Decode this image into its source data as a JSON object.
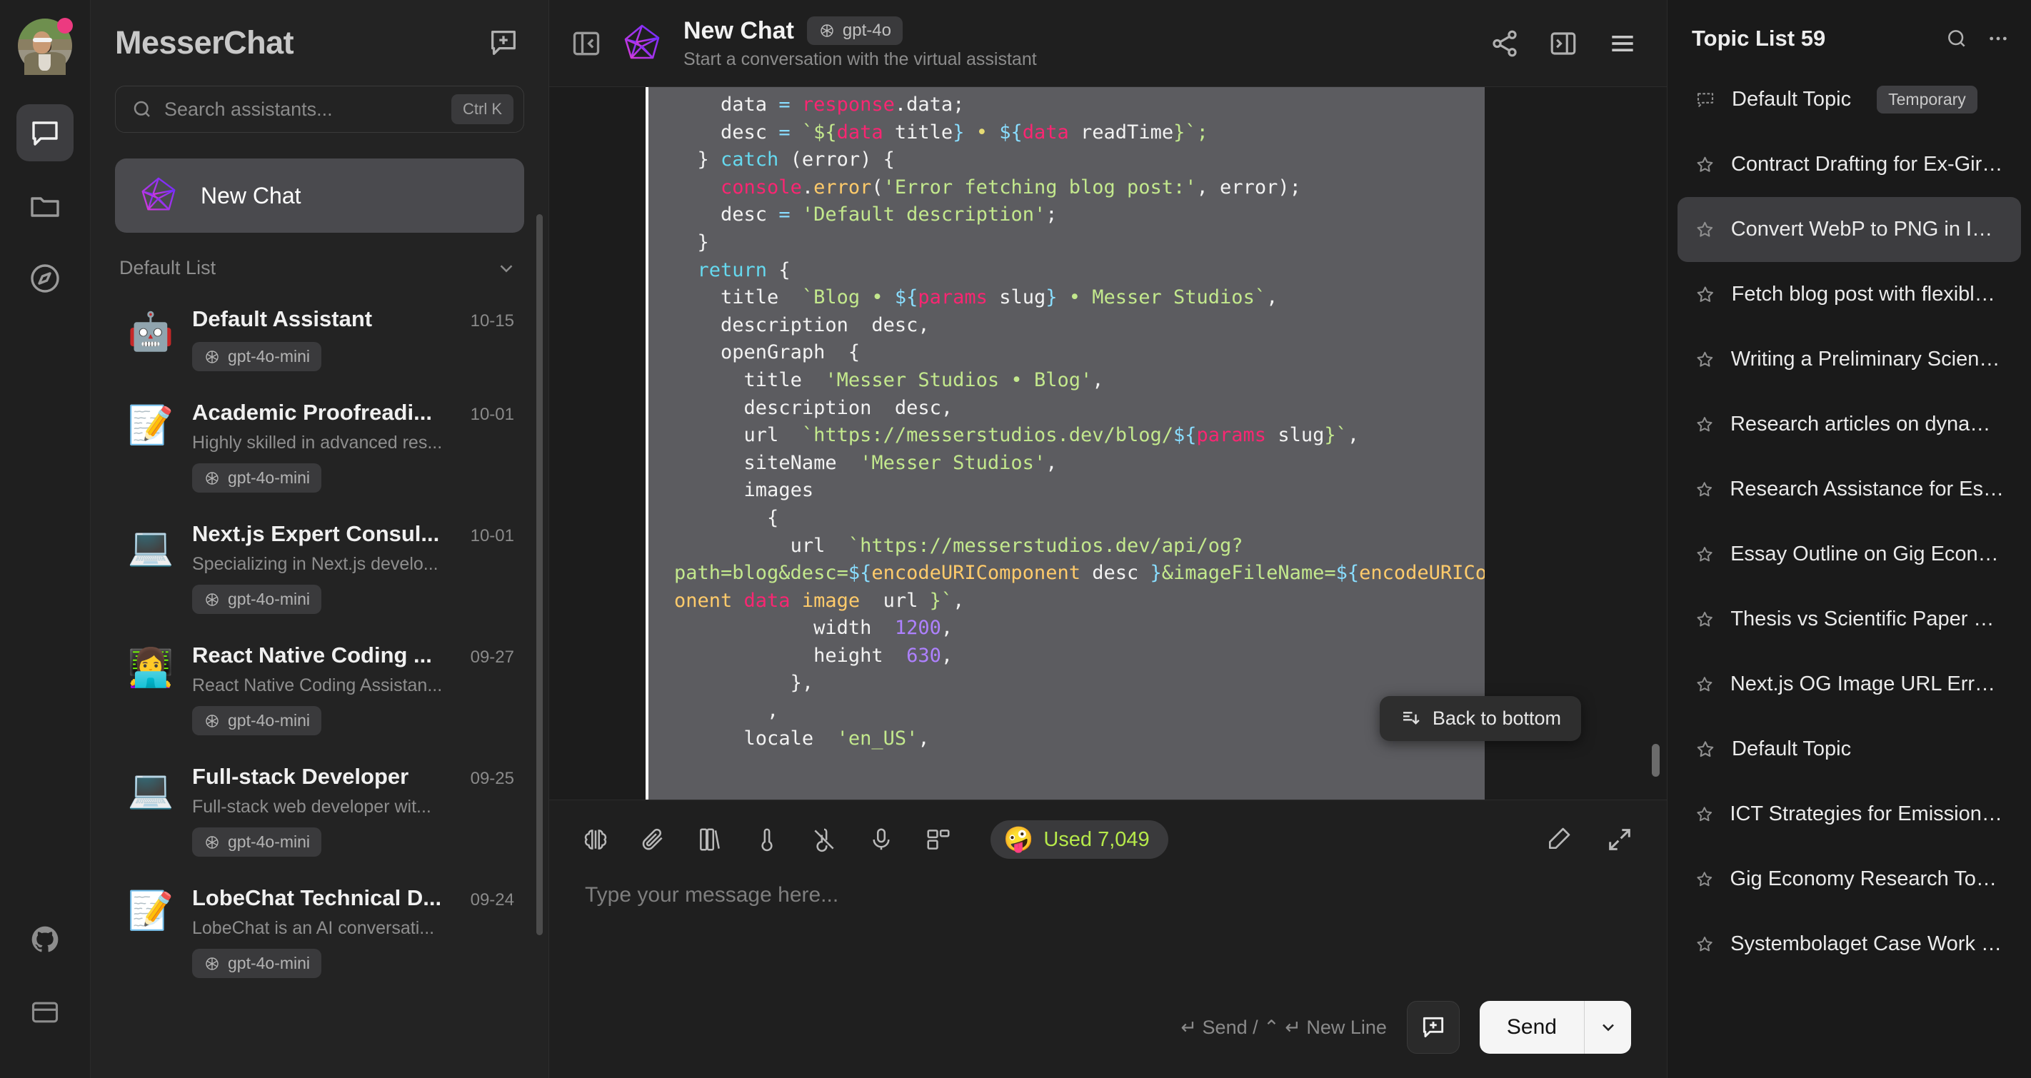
{
  "rail": {
    "avatar_name": "user-avatar",
    "items": [
      {
        "name": "chat-icon",
        "label": "Chat",
        "active": true
      },
      {
        "name": "files-icon",
        "label": "Files",
        "active": false
      },
      {
        "name": "discover-icon",
        "label": "Discover",
        "active": false
      }
    ],
    "bottom": [
      {
        "name": "github-icon",
        "label": "GitHub"
      },
      {
        "name": "docs-icon",
        "label": "Docs"
      }
    ]
  },
  "sidebar": {
    "title": "MesserChat",
    "new_session_icon": "new-chat-icon",
    "search": {
      "placeholder": "Search assistants...",
      "shortcut": "Ctrl K"
    },
    "new_chat": {
      "label": "New Chat"
    },
    "group": {
      "label": "Default List",
      "chevron": "chevron-down-icon"
    },
    "assistants": [
      {
        "emoji": "🤖",
        "name": "Default Assistant",
        "date": "10-15",
        "desc": "",
        "model": "gpt-4o-mini"
      },
      {
        "emoji": "📝",
        "name": "Academic Proofreadi...",
        "date": "10-01",
        "desc": "Highly skilled in advanced res...",
        "model": "gpt-4o-mini"
      },
      {
        "emoji": "💻",
        "name": "Next.js Expert Consul...",
        "date": "10-01",
        "desc": "Specializing in Next.js develo...",
        "model": "gpt-4o-mini"
      },
      {
        "emoji": "👩‍💻",
        "name": "React Native Coding ...",
        "date": "09-27",
        "desc": "React Native Coding Assistan...",
        "model": "gpt-4o-mini"
      },
      {
        "emoji": "💻",
        "name": "Full-stack Developer",
        "date": "09-25",
        "desc": "Full-stack web developer wit...",
        "model": "gpt-4o-mini"
      },
      {
        "emoji": "📝",
        "name": "LobeChat Technical D...",
        "date": "09-24",
        "desc": "LobeChat is an AI conversati...",
        "model": "gpt-4o-mini"
      }
    ]
  },
  "topbar": {
    "collapse_icon": "panel-collapse-icon",
    "title": "New Chat",
    "model_badge": "gpt-4o",
    "model_badge_icon": "openai-icon",
    "subtitle": "Start a conversation with the virtual assistant",
    "actions": [
      {
        "name": "share-icon"
      },
      {
        "name": "panel-expand-right-icon"
      },
      {
        "name": "menu-icon"
      }
    ]
  },
  "message": {
    "back_to_bottom": "Back to bottom",
    "back_to_bottom_icon": "scroll-to-bottom-icon",
    "code_lines": [
      {
        "indent": 4,
        "tokens": [
          {
            "t": "data",
            "c": "var"
          },
          {
            "t": " = ",
            "c": "op"
          },
          {
            "t": "response",
            "c": "pink"
          },
          {
            "t": ".data;",
            "c": "var"
          }
        ]
      },
      {
        "indent": 4,
        "tokens": [
          {
            "t": "desc",
            "c": "var"
          },
          {
            "t": " = ",
            "c": "op"
          },
          {
            "t": "`${",
            "c": "str"
          },
          {
            "t": "data",
            "c": "pink"
          },
          {
            "t": " title",
            "c": "var"
          },
          {
            "t": "} ",
            "c": "op"
          },
          {
            "t": "• ",
            "c": "yel"
          },
          {
            "t": "${",
            "c": "op"
          },
          {
            "t": "data",
            "c": "pink"
          },
          {
            "t": " readTime",
            "c": "var"
          },
          {
            "t": "}`;",
            "c": "str"
          }
        ]
      },
      {
        "indent": 2,
        "tokens": [
          {
            "t": "} ",
            "c": "var"
          },
          {
            "t": "catch",
            "c": "kw"
          },
          {
            "t": " (error) {",
            "c": "var"
          }
        ]
      },
      {
        "indent": 4,
        "tokens": [
          {
            "t": "console",
            "c": "pink"
          },
          {
            "t": ".",
            "c": "var"
          },
          {
            "t": "error",
            "c": "prop"
          },
          {
            "t": "(",
            "c": "var"
          },
          {
            "t": "'Error fetching blog post:'",
            "c": "str"
          },
          {
            "t": ", error);",
            "c": "var"
          }
        ]
      },
      {
        "indent": 4,
        "tokens": [
          {
            "t": "desc",
            "c": "var"
          },
          {
            "t": " = ",
            "c": "op"
          },
          {
            "t": "'Default description'",
            "c": "str"
          },
          {
            "t": ";",
            "c": "var"
          }
        ]
      },
      {
        "indent": 2,
        "tokens": [
          {
            "t": "}",
            "c": "var"
          }
        ]
      },
      {
        "indent": 0,
        "tokens": [
          {
            "t": "",
            "c": "var"
          }
        ]
      },
      {
        "indent": 2,
        "tokens": [
          {
            "t": "return",
            "c": "kw"
          },
          {
            "t": " {",
            "c": "var"
          }
        ]
      },
      {
        "indent": 4,
        "tokens": [
          {
            "t": "title  ",
            "c": "var"
          },
          {
            "t": "`Blog • ",
            "c": "str"
          },
          {
            "t": "${",
            "c": "op"
          },
          {
            "t": "params",
            "c": "pink"
          },
          {
            "t": " slug",
            "c": "var"
          },
          {
            "t": "} ",
            "c": "op"
          },
          {
            "t": "• Messer Studios`",
            "c": "str"
          },
          {
            "t": ",",
            "c": "var"
          }
        ]
      },
      {
        "indent": 4,
        "tokens": [
          {
            "t": "description  desc,",
            "c": "var"
          }
        ]
      },
      {
        "indent": 4,
        "tokens": [
          {
            "t": "openGraph  {",
            "c": "var"
          }
        ]
      },
      {
        "indent": 6,
        "tokens": [
          {
            "t": "title  ",
            "c": "var"
          },
          {
            "t": "'Messer Studios • Blog'",
            "c": "str"
          },
          {
            "t": ",",
            "c": "var"
          }
        ]
      },
      {
        "indent": 6,
        "tokens": [
          {
            "t": "description  desc,",
            "c": "var"
          }
        ]
      },
      {
        "indent": 6,
        "tokens": [
          {
            "t": "url  ",
            "c": "var"
          },
          {
            "t": "`https://messerstudios.dev/blog/",
            "c": "str"
          },
          {
            "t": "${",
            "c": "op"
          },
          {
            "t": "params",
            "c": "pink"
          },
          {
            "t": " slug",
            "c": "var"
          },
          {
            "t": "}`",
            "c": "str"
          },
          {
            "t": ",",
            "c": "var"
          }
        ]
      },
      {
        "indent": 6,
        "tokens": [
          {
            "t": "siteName  ",
            "c": "var"
          },
          {
            "t": "'Messer Studios'",
            "c": "str"
          },
          {
            "t": ",",
            "c": "var"
          }
        ]
      },
      {
        "indent": 6,
        "tokens": [
          {
            "t": "images",
            "c": "var"
          }
        ]
      },
      {
        "indent": 8,
        "tokens": [
          {
            "t": "{",
            "c": "var"
          }
        ]
      },
      {
        "indent": 10,
        "tokens": [
          {
            "t": "url  ",
            "c": "var"
          },
          {
            "t": "`https://messerstudios.dev/api/og?",
            "c": "str"
          }
        ]
      },
      {
        "indent": 0,
        "tokens": [
          {
            "t": "path=blog&desc=",
            "c": "str"
          },
          {
            "t": "${",
            "c": "op"
          },
          {
            "t": "encodeURIComponent",
            "c": "prop"
          },
          {
            "t": " desc ",
            "c": "var"
          },
          {
            "t": "}",
            "c": "op"
          },
          {
            "t": "&imageFileName=",
            "c": "str"
          },
          {
            "t": "${",
            "c": "op"
          },
          {
            "t": "encodeURIComp",
            "c": "prop"
          }
        ]
      },
      {
        "indent": 0,
        "tokens": [
          {
            "t": "onent",
            "c": "prop"
          },
          {
            "t": " data",
            "c": "pink"
          },
          {
            "t": " image",
            "c": "prop"
          },
          {
            "t": "  url ",
            "c": "var"
          },
          {
            "t": "}`",
            "c": "str"
          },
          {
            "t": ",",
            "c": "var"
          }
        ]
      },
      {
        "indent": 12,
        "tokens": [
          {
            "t": "width  ",
            "c": "var"
          },
          {
            "t": "1200",
            "c": "num"
          },
          {
            "t": ",",
            "c": "var"
          }
        ]
      },
      {
        "indent": 12,
        "tokens": [
          {
            "t": "height  ",
            "c": "var"
          },
          {
            "t": "630",
            "c": "num"
          },
          {
            "t": ",",
            "c": "var"
          }
        ]
      },
      {
        "indent": 10,
        "tokens": [
          {
            "t": "},",
            "c": "var"
          }
        ]
      },
      {
        "indent": 8,
        "tokens": [
          {
            "t": ",",
            "c": "var"
          }
        ]
      },
      {
        "indent": 6,
        "tokens": [
          {
            "t": "locale  ",
            "c": "var"
          },
          {
            "t": "'en_US'",
            "c": "str"
          },
          {
            "t": ",",
            "c": "var"
          }
        ]
      }
    ]
  },
  "composer": {
    "tools": [
      {
        "name": "model-brain-icon"
      },
      {
        "name": "attachment-icon"
      },
      {
        "name": "knowledge-base-icon"
      },
      {
        "name": "temperature-icon"
      },
      {
        "name": "no-image-icon"
      },
      {
        "name": "microphone-icon"
      },
      {
        "name": "plugins-icon"
      }
    ],
    "used_chip": {
      "emoji": "🤪",
      "label": "Used 7,049"
    },
    "tools_right": [
      {
        "name": "clear-icon"
      },
      {
        "name": "expand-icon"
      }
    ],
    "input_placeholder": "Type your message here...",
    "hint": "↵ Send / ⌃ ↵ New Line",
    "new_topic_icon": "new-topic-icon",
    "send_label": "Send",
    "send_caret_icon": "chevron-down-icon"
  },
  "topics": {
    "title": "Topic List 59",
    "search_icon": "search-icon",
    "more_icon": "more-horizontal-icon",
    "items": [
      {
        "icon": "temp-topic-icon",
        "label": "Default Topic",
        "badge": "Temporary",
        "active": false
      },
      {
        "icon": "star-icon",
        "label": "Contract Drafting for Ex-Girlfr...",
        "badge": "",
        "active": false
      },
      {
        "icon": "star-icon",
        "label": "Convert WebP to PNG in Ima...",
        "badge": "",
        "active": true
      },
      {
        "icon": "star-icon",
        "label": "Fetch blog post with flexible ...",
        "badge": "",
        "active": false
      },
      {
        "icon": "star-icon",
        "label": "Writing a Preliminary Scientifi...",
        "badge": "",
        "active": false
      },
      {
        "icon": "star-icon",
        "label": "Research articles on dynamic ...",
        "badge": "",
        "active": false
      },
      {
        "icon": "star-icon",
        "label": "Research Assistance for Essay...",
        "badge": "",
        "active": false
      },
      {
        "icon": "star-icon",
        "label": "Essay Outline on Gig Econom...",
        "badge": "",
        "active": false
      },
      {
        "icon": "star-icon",
        "label": "Thesis vs Scientific Paper Diff...",
        "badge": "",
        "active": false
      },
      {
        "icon": "star-icon",
        "label": "Next.js OG Image URL Error Fix",
        "badge": "",
        "active": false
      },
      {
        "icon": "star-icon",
        "label": "Default Topic",
        "badge": "",
        "active": false
      },
      {
        "icon": "star-icon",
        "label": "ICT Strategies for Emission Re...",
        "badge": "",
        "active": false
      },
      {
        "icon": "star-icon",
        "label": "Gig Economy Research Topics...",
        "badge": "",
        "active": false
      },
      {
        "icon": "star-icon",
        "label": "Systembolaget Case Work Ov...",
        "badge": "",
        "active": false
      }
    ]
  },
  "colors": {
    "accent_purple": "#8b3dff",
    "badge_pink": "#ec3a80",
    "used_green": "#b6e94a",
    "panel_bg": "#1f1f1f",
    "code_bg": "#5c5c60"
  }
}
